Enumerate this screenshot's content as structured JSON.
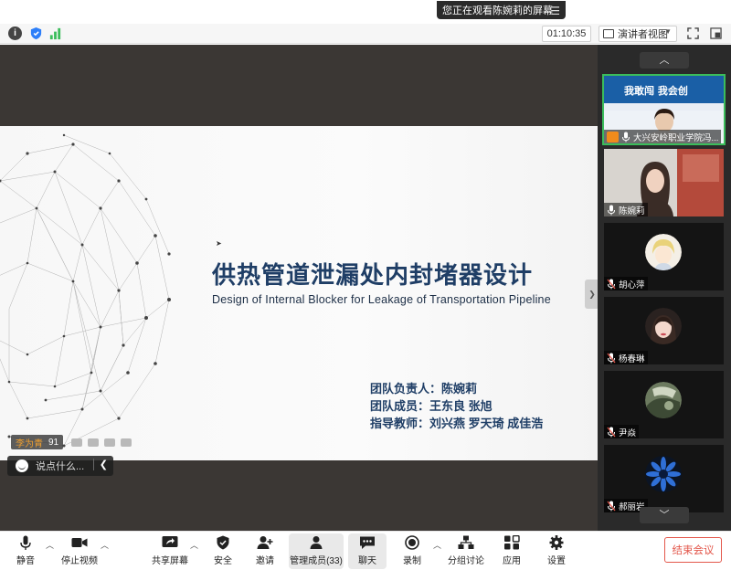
{
  "share_notice": {
    "text": "您正在观看陈婉莉的屏幕",
    "menu_icon": "hamburger-icon"
  },
  "info_bar": {
    "timer": "01:10:35",
    "view_label": "演讲者视图",
    "signal_color": "#3bbd5b",
    "shield_color": "#2d7ff9"
  },
  "slide": {
    "title": "供热管道泄漏处内封堵器设计",
    "subtitle": "Design of Internal Blocker for Leakage of  Transportation Pipeline",
    "team_lines": [
      "团队负责人：陈婉莉",
      "团队成员：王东良  张旭",
      "指导教师：刘兴燕   罗天琦   成佳浩"
    ],
    "title_color": "#1f3e66"
  },
  "overlay": {
    "name_tag_name": "李为青",
    "name_tag_count": "91",
    "chat_placeholder": "说点什么..."
  },
  "participants": [
    {
      "name": "大兴安岭职业学院冯...",
      "hand_raised": true,
      "banner_text": "我敢闯 我会创"
    },
    {
      "name": "陈婉莉"
    },
    {
      "name": "胡心萍"
    },
    {
      "name": "杨春琳"
    },
    {
      "name": "尹焱"
    },
    {
      "name": "郝丽岩"
    }
  ],
  "toolbar": {
    "mute": "静音",
    "stop_video": "停止视频",
    "share_screen": "共享屏幕",
    "security": "安全",
    "invite": "邀请",
    "manage_participants": "管理成员(33)",
    "chat": "聊天",
    "record": "录制",
    "breakout": "分组讨论",
    "apps": "应用",
    "settings": "设置",
    "end_meeting": "结束会议"
  },
  "colors": {
    "accent_green": "#3bbd5b",
    "end_red": "#e3574b",
    "panel_bg": "#2a2a2a",
    "share_bg": "#3b3734"
  }
}
